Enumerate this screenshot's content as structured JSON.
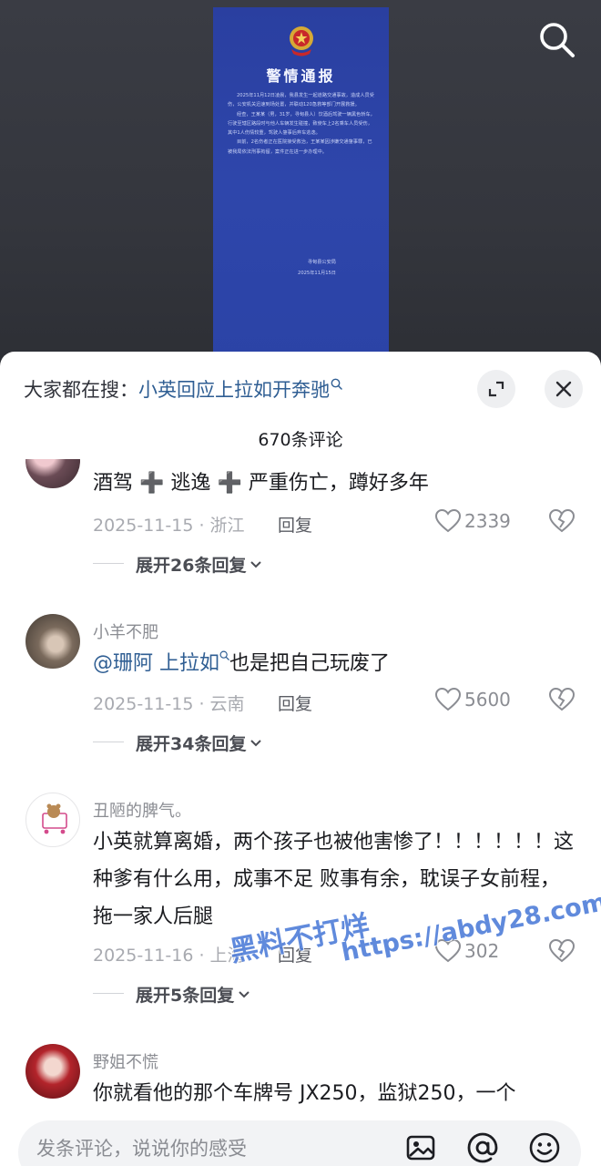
{
  "notice": {
    "title": "警情通报",
    "body": [
      "2025年11月12日凌晨，我县发生一起道路交通事故，造成人员受伤，公安机关迅速到场处置，并联动120急救等部门开展救援。",
      "经查，王某某（男，31岁，寻甸县人）饮酒后驾驶一辆黑色轿车，行驶至辖区路段时与他人车辆发生碰撞，致使车上2名乘车人员受伤，其中1人伤情较重，驾驶人肇事后弃车逃逸。",
      "目前，2名伤者正在医院接受救治，王某某因涉嫌交通肇事罪，已被我局依法刑事拘留，案件正在进一步办理中。"
    ],
    "org": "寻甸县公安局",
    "date": "2025年11月15日"
  },
  "header": {
    "hot_search_prefix": "大家都在搜：",
    "hot_search_query": "小英回应上拉如开奔驰",
    "comment_count": "670条评论"
  },
  "comments": [
    {
      "username": "",
      "text_parts": [
        "酒驾",
        "➕",
        "逃逸",
        "➕",
        "严重伤亡，蹲好多年"
      ],
      "date_location": "2025-11-15 · 浙江",
      "reply_label": "回复",
      "likes": "2339",
      "expand_label": "展开26条回复"
    },
    {
      "username": "小羊不肥",
      "mention": "@珊阿 上拉如",
      "text": "也是把自己玩废了",
      "date_location": "2025-11-15 · 云南",
      "reply_label": "回复",
      "likes": "5600",
      "expand_label": "展开34条回复"
    },
    {
      "username": "丑陋的脾气。",
      "text": "小英就算离婚，两个孩子也被他害惨了！！！！！！这种爹有什么用，成事不足 败事有余，耽误子女前程，拖一家人后腿",
      "date_location": "2025-11-16 · 上海",
      "reply_label": "回复",
      "likes": "302",
      "expand_label": "展开5条回复"
    },
    {
      "username": "野姐不慌",
      "text": "你就看他的那个车牌号 JX250，监狱250，一个"
    }
  ],
  "watermark": {
    "line1": "黑料不打烊",
    "line2": "https://abdy28.com"
  },
  "input": {
    "placeholder": "发条评论，说说你的感受"
  },
  "icons": [
    "search-icon",
    "expand-icon",
    "close-icon",
    "heart-icon",
    "broken-heart-icon",
    "chevron-down-icon",
    "image-icon",
    "at-icon",
    "emoji-icon",
    "police-emblem-icon"
  ],
  "colors": {
    "link": "#2f5e93",
    "notice_bg": "#2e46ab",
    "sheet_bg": "#ffffff"
  }
}
